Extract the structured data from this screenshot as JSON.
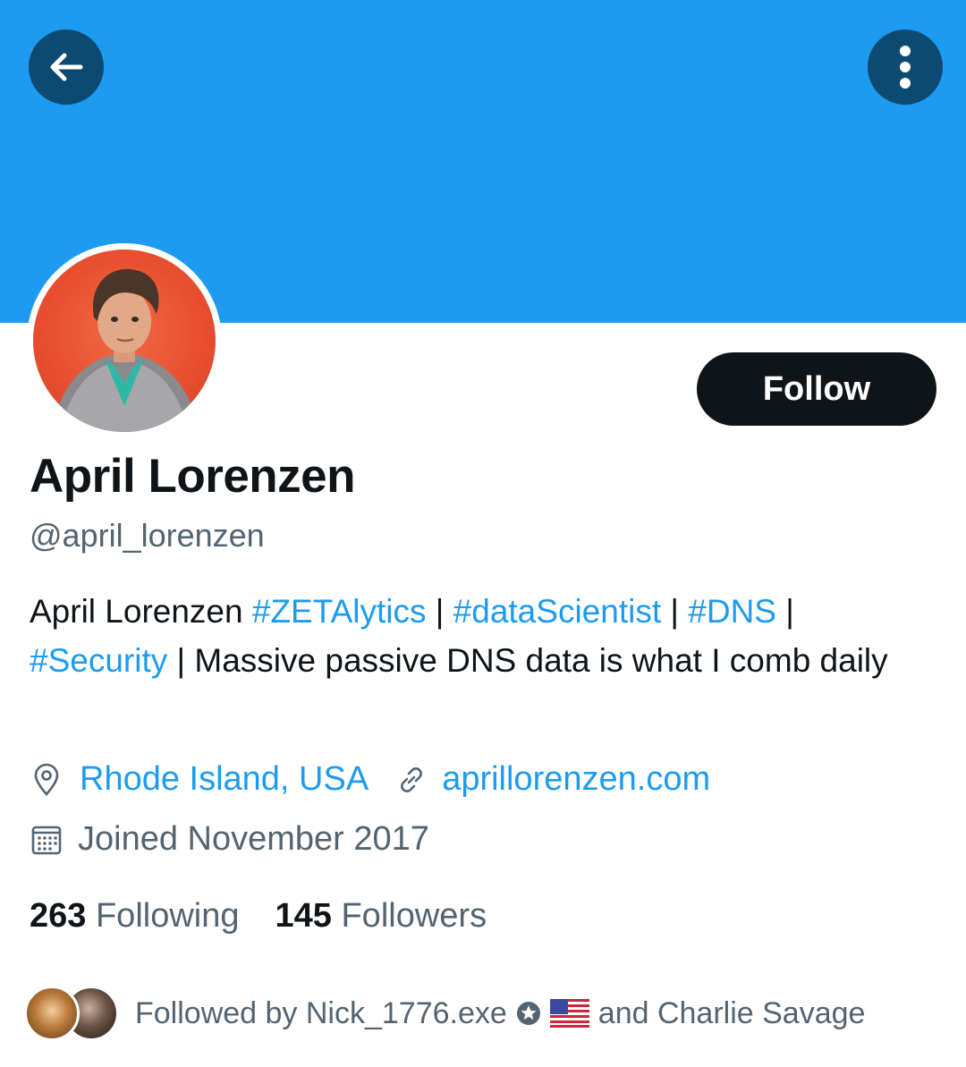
{
  "profile": {
    "name": "April Lorenzen",
    "handle": "@april_lorenzen",
    "follow_label": "Follow",
    "bio": {
      "text_start": "April Lorenzen ",
      "tag1": "#ZETAlytics",
      "sep1": " | ",
      "tag2": "#dataScientist",
      "sep2": " | ",
      "tag3": "#DNS",
      "sep3": " | ",
      "tag4": "#Security",
      "text_end": " | Massive passive DNS data is what I comb daily"
    },
    "location": "Rhode Island, USA",
    "website": "aprillorenzen.com",
    "joined": "Joined November 2017",
    "following_count": "263",
    "following_label": "Following",
    "followers_count": "145",
    "followers_label": "Followers",
    "followed_by": {
      "prefix": "Followed by Nick_1776.exe",
      "suffix": "and Charlie Savage"
    }
  },
  "colors": {
    "banner": "#1d9bf0",
    "accent": "#1d9bf0",
    "button": "#0f1419",
    "muted": "#536471"
  },
  "icons": [
    "back-arrow-icon",
    "more-vertical-icon",
    "location-pin-icon",
    "link-icon",
    "calendar-icon",
    "star-badge-icon",
    "us-flag-icon"
  ]
}
